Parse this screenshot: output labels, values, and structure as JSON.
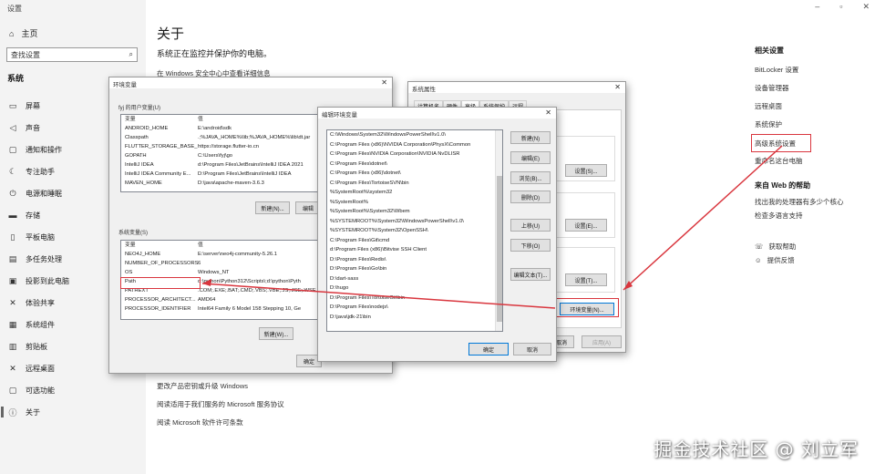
{
  "settings": {
    "window_title": "设置",
    "home": "主页",
    "search_placeholder": "查找设置",
    "section": "系统",
    "nav": [
      {
        "label": "屏幕",
        "icon": "monitor-icon"
      },
      {
        "label": "声音",
        "icon": "speaker-icon"
      },
      {
        "label": "通知和操作",
        "icon": "notification-icon"
      },
      {
        "label": "专注助手",
        "icon": "moon-icon"
      },
      {
        "label": "电源和睡眠",
        "icon": "power-icon"
      },
      {
        "label": "存储",
        "icon": "storage-icon"
      },
      {
        "label": "平板电脑",
        "icon": "tablet-icon"
      },
      {
        "label": "多任务处理",
        "icon": "multitask-icon"
      },
      {
        "label": "投影到此电脑",
        "icon": "projector-icon"
      },
      {
        "label": "体验共享",
        "icon": "share-icon"
      },
      {
        "label": "系统组件",
        "icon": "components-icon"
      },
      {
        "label": "剪贴板",
        "icon": "clipboard-icon"
      },
      {
        "label": "远程桌面",
        "icon": "remote-icon"
      },
      {
        "label": "可选功能",
        "icon": "optional-icon"
      },
      {
        "label": "关于",
        "icon": "info-icon"
      }
    ],
    "main_title": "关于",
    "main_subtitle": "系统正在监控并保护你的电脑。",
    "main_link": "在 Windows 安全中心中查看详细信息",
    "bottom_links": [
      "更改产品密钥或升级 Windows",
      "阅读适用于我们服务的 Microsoft 服务协议",
      "阅读 Microsoft 软件许可条款"
    ],
    "related_title": "相关设置",
    "related_links": [
      "BitLocker 设置",
      "设备管理器",
      "远程桌面",
      "系统保护",
      "高级系统设置",
      "重命名这台电脑"
    ],
    "help_title": "来自 Web 的帮助",
    "help_links": [
      "找出我的处理器有多少个核心",
      "检查多语言支持"
    ],
    "get_help": "获取帮助",
    "feedback": "提供反馈"
  },
  "env_dialog": {
    "title": "环境变量",
    "user_group": "fyj 的用户变量(U)",
    "col_var": "变量",
    "col_val": "值",
    "user_vars": [
      [
        "ANDROID_HOME",
        "E:\\android\\sdk"
      ],
      [
        "Classpath",
        ".;%JAVA_HOME%\\lib;%JAVA_HOME%\\lib\\dt.jar"
      ],
      [
        "FLUTTER_STORAGE_BASE_...",
        "https://storage.flutter-io.cn"
      ],
      [
        "GOPATH",
        "C:\\Users\\fyj\\go"
      ],
      [
        "IntelliJ IDEA",
        "d:\\Program Files\\JetBrains\\IntelliJ IDEA 2021"
      ],
      [
        "IntelliJ IDEA Community E...",
        "D:\\Program Files\\JetBrains\\IntelliJ IDEA"
      ],
      [
        "MAVEN_HOME",
        "D:\\java\\apache-maven-3.6.3"
      ]
    ],
    "new_btn": "新建(N)...",
    "edit_btn": "编辑",
    "sys_group": "系统变量(S)",
    "sys_vars": [
      [
        "NEO4J_HOME",
        "E:\\server\\neo4j-community-5.26.1"
      ],
      [
        "NUMBER_OF_PROCESSORS",
        "6"
      ],
      [
        "OS",
        "Windows_NT"
      ],
      [
        "Path",
        "d:\\python\\Python312\\Scripts\\;d:\\python\\Pyth"
      ],
      [
        "PATHEXT",
        ".COM;.EXE;.BAT;.CMD;.VBS;.VBE;.JS;.JSE;.WSF"
      ],
      [
        "PROCESSOR_ARCHITECT...",
        "AMD64"
      ],
      [
        "PROCESSOR_IDENTIFIER",
        "Intel64 Family 6 Model 158 Stepping 10, Ge"
      ]
    ],
    "sys_new_btn": "新建(W)...",
    "ok": "确定"
  },
  "sys_dialog": {
    "title": "系统属性",
    "tabs": [
      "计算机名",
      "硬件",
      "高级",
      "系统保护",
      "远程"
    ],
    "settings_btn_1": "设置(S)...",
    "settings_btn_2": "设置(E)...",
    "settings_btn_3": "设置(T)...",
    "env_btn": "环境变量(N)...",
    "cancel": "取消",
    "apply": "应用(A)"
  },
  "edit_dialog": {
    "title": "编辑环境变量",
    "paths": [
      "C:\\Windows\\System32\\WindowsPowerShell\\v1.0\\",
      "C:\\Program Files (x86)\\NVIDIA Corporation\\PhysX\\Common",
      "C:\\Program Files\\NVIDIA Corporation\\NVIDIA NvDLISR",
      "C:\\Program Files\\dotnet\\",
      "C:\\Program Files (x86)\\dotnet\\",
      "C:\\Program Files\\TortoiseSVN\\bin",
      "%SystemRoot%\\system32",
      "%SystemRoot%",
      "%SystemRoot%\\System32\\Wbem",
      "%SYSTEMROOT%\\System32\\WindowsPowerShell\\v1.0\\",
      "%SYSTEMROOT%\\System32\\OpenSSH\\",
      "C:\\Program Files\\Git\\cmd",
      "d:\\Program Files (x86)\\Bitvise SSH Client",
      "D:\\Program Files\\Redis\\",
      "D:\\Program Files\\Go\\bin",
      "D:\\dart-sass",
      "D:\\hugo",
      "D:\\Program Files\\TortoiseGit\\bin",
      "D:\\Program Files\\nodejs\\",
      "D:\\java\\jdk-21\\bin"
    ],
    "btn_new": "新建(N)",
    "btn_edit": "编辑(E)",
    "btn_browse": "浏览(B)...",
    "btn_delete": "删除(D)",
    "btn_up": "上移(U)",
    "btn_down": "下移(O)",
    "btn_edit_text": "编辑文本(T)...",
    "ok": "确定",
    "cancel": "取消"
  },
  "watermark": "掘金技术社区 @ 刘立军",
  "colors": {
    "highlight": "#d9363e",
    "sidebar": "#f3f3f3",
    "dialog": "#f0f0f0"
  }
}
